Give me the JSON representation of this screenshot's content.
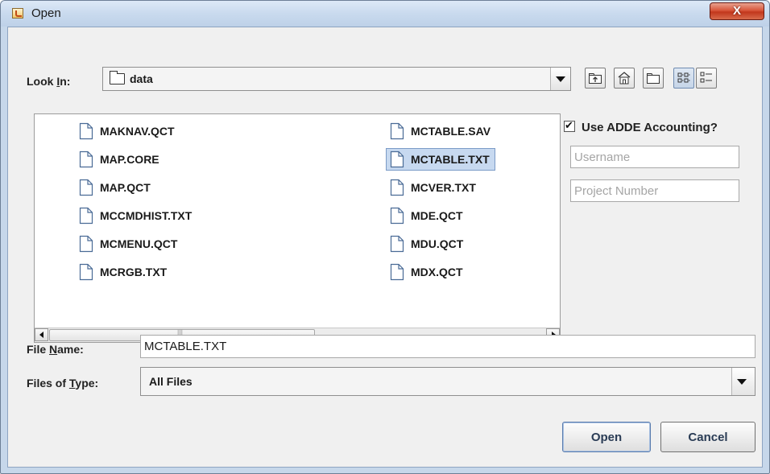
{
  "window": {
    "title": "Open",
    "close_label": "X"
  },
  "look_in": {
    "label_prefix": "Look ",
    "label_mnemonic": "I",
    "label_suffix": "n:",
    "value": "data"
  },
  "toolbar": {
    "icons": [
      "up-one-level-icon",
      "home-icon",
      "new-folder-icon",
      "list-view-icon",
      "details-view-icon"
    ],
    "selected_view": "list"
  },
  "files": {
    "column1": [
      "MAKNAV.QCT",
      "MAP.CORE",
      "MAP.QCT",
      "MCCMDHIST.TXT",
      "MCMENU.QCT",
      "MCRGB.TXT"
    ],
    "column2": [
      "MCTABLE.SAV",
      "MCTABLE.TXT",
      "MCVER.TXT",
      "MDE.QCT",
      "MDU.QCT",
      "MDX.QCT"
    ],
    "selected": "MCTABLE.TXT"
  },
  "adde": {
    "checkbox_label": "Use ADDE Accounting?",
    "checked": true,
    "username_placeholder": "Username",
    "project_placeholder": "Project Number"
  },
  "file_name": {
    "label_prefix": "File ",
    "label_mnemonic": "N",
    "label_suffix": "ame:",
    "value": "MCTABLE.TXT"
  },
  "file_type": {
    "label_prefix": "Files of ",
    "label_mnemonic": "T",
    "label_suffix": "ype:",
    "value": "All Files"
  },
  "buttons": {
    "open": "Open",
    "cancel": "Cancel"
  }
}
